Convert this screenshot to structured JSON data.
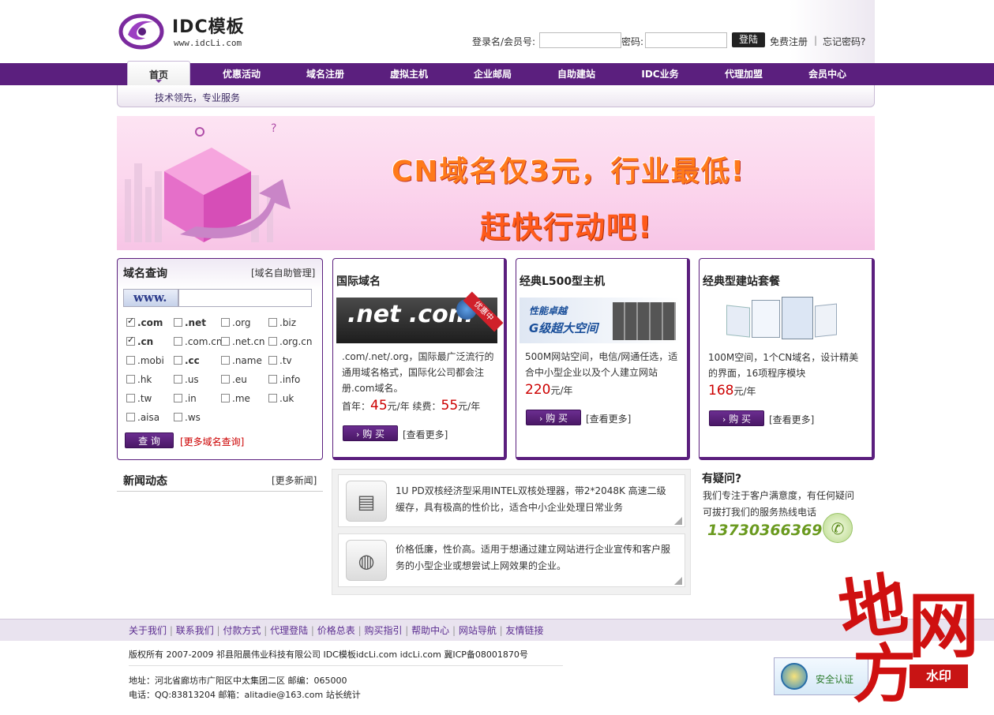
{
  "logo": {
    "title": "IDC模板",
    "url": "www.idcLi.com"
  },
  "login": {
    "user_label": "登录名/会员号:",
    "pwd_label": "密码:",
    "login_button": "登陆",
    "register_link": "免费注册",
    "forgot_link": "忘记密码?",
    "sep": "|"
  },
  "nav": {
    "items": [
      "首页",
      "优惠活动",
      "域名注册",
      "虚拟主机",
      "企业邮局",
      "自助建站",
      "IDC业务",
      "代理加盟",
      "会员中心"
    ]
  },
  "subnav": {
    "text": "技术领先，专业服务"
  },
  "banner": {
    "line1": "CN域名仅3元，行业最低!",
    "line2": "赶快行动吧!"
  },
  "domain_search": {
    "title": "域名查询",
    "manage_link": "[域名自助管理]",
    "prefix": "www.",
    "input_value": "",
    "tlds": [
      {
        "label": ".com",
        "checked": true,
        "bold": true
      },
      {
        "label": ".net",
        "checked": false,
        "bold": true
      },
      {
        "label": ".org",
        "checked": false,
        "bold": false
      },
      {
        "label": ".biz",
        "checked": false,
        "bold": false
      },
      {
        "label": ".cn",
        "checked": true,
        "bold": true
      },
      {
        "label": ".com.cn",
        "checked": false,
        "bold": false
      },
      {
        "label": ".net.cn",
        "checked": false,
        "bold": false
      },
      {
        "label": ".org.cn",
        "checked": false,
        "bold": false
      },
      {
        "label": ".mobi",
        "checked": false,
        "bold": false
      },
      {
        "label": ".cc",
        "checked": false,
        "bold": true
      },
      {
        "label": ".name",
        "checked": false,
        "bold": false
      },
      {
        "label": ".tv",
        "checked": false,
        "bold": false
      },
      {
        "label": ".hk",
        "checked": false,
        "bold": false
      },
      {
        "label": ".us",
        "checked": false,
        "bold": false
      },
      {
        "label": ".eu",
        "checked": false,
        "bold": false
      },
      {
        "label": ".info",
        "checked": false,
        "bold": false
      },
      {
        "label": ".tw",
        "checked": false,
        "bold": false
      },
      {
        "label": ".in",
        "checked": false,
        "bold": false
      },
      {
        "label": ".me",
        "checked": false,
        "bold": false
      },
      {
        "label": ".uk",
        "checked": false,
        "bold": false
      },
      {
        "label": ".aisa",
        "checked": false,
        "bold": false
      },
      {
        "label": ".ws",
        "checked": false,
        "bold": false
      }
    ],
    "search_button": "查 询",
    "more_link": "[更多域名查询]"
  },
  "card_intl": {
    "title": "国际域名",
    "img_text": ".net .com",
    "badge": "优惠中",
    "desc": ".com/.net/.org，国际最广泛流行的通用域名格式，国际化公司都会注册.com域名。",
    "price_first_label": "首年：",
    "price_first": "45",
    "price_unit": "元/年",
    "price_renew_label": " 续费：",
    "price_renew": "55",
    "buy_button": "购 买",
    "more_link": "[查看更多]"
  },
  "card_host": {
    "title": "经典L500型主机",
    "img_text1": "性能卓越",
    "img_text2": "G级超大空间",
    "desc": "500M网站空间，电信/网通任选，适合中小型企业以及个人建立网站",
    "price": "220",
    "price_unit": "元/年",
    "buy_button": "购 买",
    "more_link": "[查看更多]"
  },
  "card_site": {
    "title": "经典型建站套餐",
    "desc": "100M空间，1个CN域名，设计精美的界面，16项程序模块",
    "price": "168",
    "price_unit": "元/年",
    "buy_button": "购 买",
    "more_link": "[查看更多]"
  },
  "news": {
    "title": "新闻动态",
    "more_link": "[更多新闻]"
  },
  "features": [
    {
      "text": "1U PD双核经济型采用INTEL双核处理器，带2*2048K 高速二级缓存，具有极高的性价比，适合中小企业处理日常业务"
    },
    {
      "text": "价格低廉，性价高。适用于想通过建立网站进行企业宣传和客户服务的小型企业或想尝试上网效果的企业。"
    }
  ],
  "faq": {
    "title": "有疑问?",
    "desc": "我们专注于客户满意度，有任何疑问可拔打我们的服务热线电话",
    "phone": "13730366369"
  },
  "footer": {
    "links": [
      "关于我们",
      "联系我们",
      "付款方式",
      "代理登陆",
      "价格总表",
      "购买指引",
      "帮助中心",
      "网站导航",
      "友情链接"
    ],
    "copyright": "版权所有 2007-2009 祁县阳晨伟业科技有限公司 IDC模板idcLi.com idcLi.com 冀ICP备08001870号",
    "address": "地址：河北省廊坊市广阳区中太集团二区 邮编：065000",
    "contact": "电话：QQ:83813204 邮箱：alitadie@163.com 站长统计",
    "security": "安全认证"
  },
  "watermark": {
    "chars": [
      "地",
      "网",
      "方"
    ],
    "stamp": "水印"
  },
  "colors": {
    "brand": "#5b1f7e",
    "price": "#cc0000",
    "phone": "#6a9a1f"
  }
}
